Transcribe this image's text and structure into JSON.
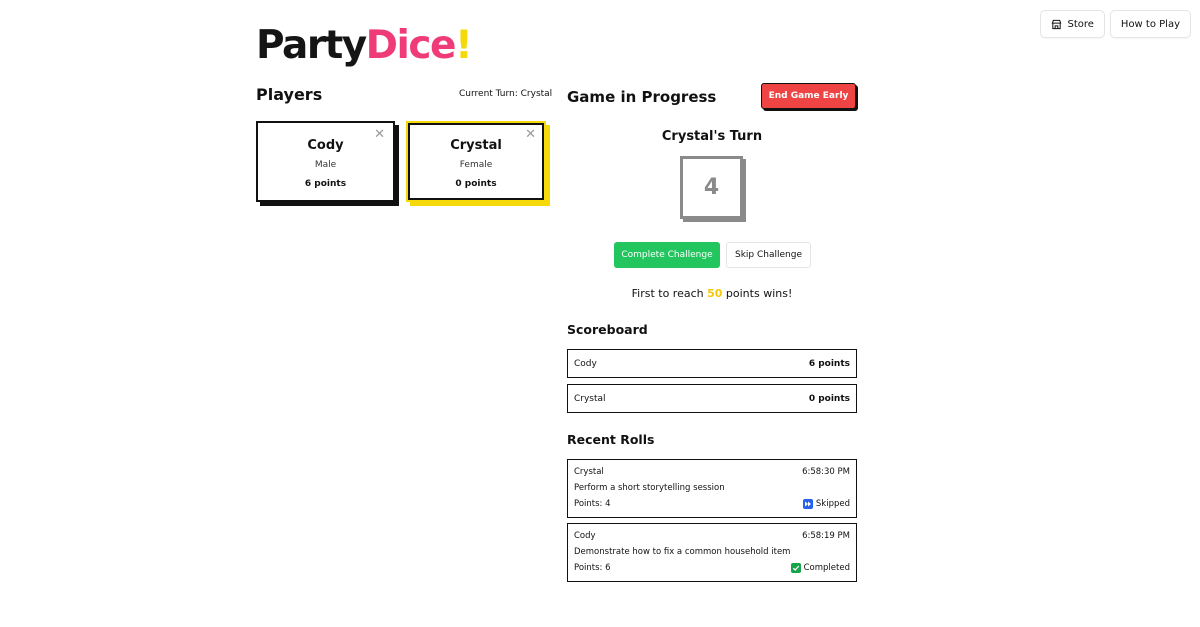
{
  "nav": {
    "store_label": "Store",
    "how_to_play_label": "How to Play"
  },
  "logo": {
    "part1": "Party",
    "part2": "Dice",
    "part3": "!"
  },
  "players": {
    "title": "Players",
    "current_turn": "Current Turn: Crystal",
    "cards": [
      {
        "name": "Cody",
        "gender": "Male",
        "points": "6 points"
      },
      {
        "name": "Crystal",
        "gender": "Female",
        "points": "0 points"
      }
    ]
  },
  "game": {
    "title": "Game in Progress",
    "end_label": "End Game Early",
    "turn_title": "Crystal's Turn",
    "die_value": "4",
    "complete_label": "Complete Challenge",
    "skip_label": "Skip Challenge",
    "win_prefix": "First to reach ",
    "win_target": "50",
    "win_suffix": " points wins!"
  },
  "scoreboard": {
    "title": "Scoreboard",
    "rows": [
      {
        "name": "Cody",
        "points": "6 points"
      },
      {
        "name": "Crystal",
        "points": "0 points"
      }
    ]
  },
  "recent": {
    "title": "Recent Rolls",
    "rolls": [
      {
        "player": "Crystal",
        "time": "6:58:30 PM",
        "challenge": "Perform a short storytelling session",
        "points": "Points: 4",
        "status": "Skipped"
      },
      {
        "player": "Cody",
        "time": "6:58:19 PM",
        "challenge": "Demonstrate how to fix a common household item",
        "points": "Points: 6",
        "status": "Completed"
      }
    ]
  },
  "colors": {
    "accent_pink": "#ef3c78",
    "accent_yellow": "#f5d90a",
    "danger": "#ef4444",
    "success": "#22c55e"
  }
}
